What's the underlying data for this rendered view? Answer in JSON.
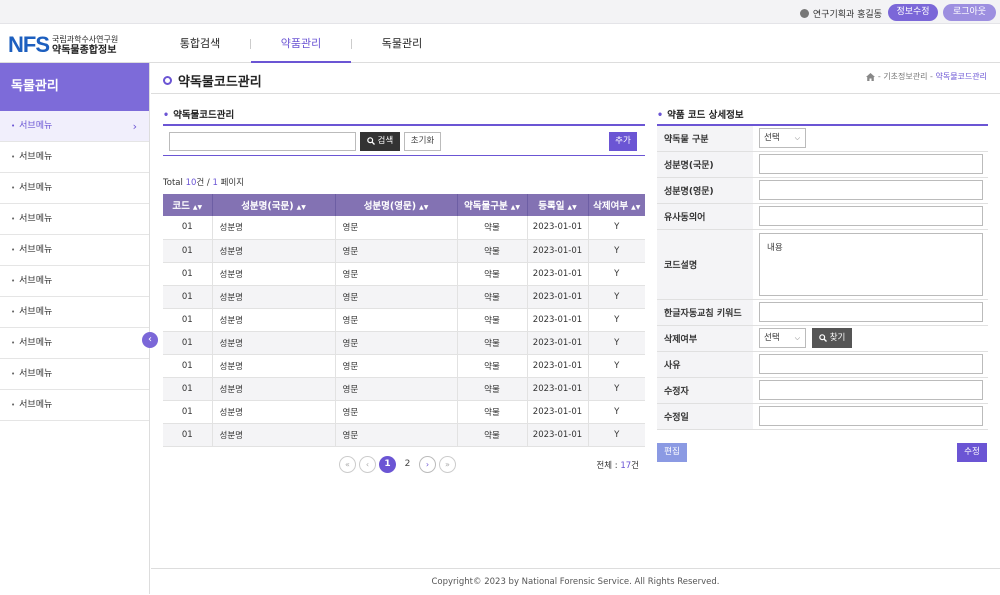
{
  "topbar": {
    "user_text": "연구기획과 홍길동",
    "profile_btn": "정보수정",
    "logout_btn": "로그아웃"
  },
  "logo": {
    "mark": "NFS",
    "org_line1": "국립과학수사연구원",
    "org_line2": "약독물종합정보"
  },
  "gnb": [
    {
      "label": "통합검색"
    },
    {
      "label": "약품관리"
    },
    {
      "label": "독물관리"
    }
  ],
  "sidebar": {
    "title": "독물관리",
    "items": [
      {
        "label": "서브메뉴"
      },
      {
        "label": "서브메뉴"
      },
      {
        "label": "서브메뉴"
      },
      {
        "label": "서브메뉴"
      },
      {
        "label": "서브메뉴"
      },
      {
        "label": "서브메뉴"
      },
      {
        "label": "서브메뉴"
      },
      {
        "label": "서브메뉴"
      },
      {
        "label": "서브메뉴"
      },
      {
        "label": "서브메뉴"
      }
    ]
  },
  "page": {
    "title": "약독물코드관리",
    "breadcrumb": {
      "path": "- 기초정보관리 -",
      "current": "약독물코드관리"
    }
  },
  "list": {
    "section_title": "약독물코드관리",
    "search_btn": "검색",
    "reset_btn": "초기화",
    "add_btn": "추가",
    "total_prefix": "Total ",
    "total_count": "10",
    "total_mid": "건 / ",
    "total_pages": "1",
    "total_suffix": " 페이지",
    "columns": [
      "코드",
      "성분명(국문)",
      "성분명(영문)",
      "약독물구분",
      "등록일",
      "삭제여부"
    ],
    "rows": [
      {
        "code": "01",
        "kor": "성분명",
        "eng": "영문",
        "type": "약물",
        "date": "2023-01-01",
        "del": "Y"
      },
      {
        "code": "01",
        "kor": "성분명",
        "eng": "영문",
        "type": "약물",
        "date": "2023-01-01",
        "del": "Y"
      },
      {
        "code": "01",
        "kor": "성분명",
        "eng": "영문",
        "type": "약물",
        "date": "2023-01-01",
        "del": "Y"
      },
      {
        "code": "01",
        "kor": "성분명",
        "eng": "영문",
        "type": "약물",
        "date": "2023-01-01",
        "del": "Y"
      },
      {
        "code": "01",
        "kor": "성분명",
        "eng": "영문",
        "type": "약물",
        "date": "2023-01-01",
        "del": "Y"
      },
      {
        "code": "01",
        "kor": "성분명",
        "eng": "영문",
        "type": "약물",
        "date": "2023-01-01",
        "del": "Y"
      },
      {
        "code": "01",
        "kor": "성분명",
        "eng": "영문",
        "type": "약물",
        "date": "2023-01-01",
        "del": "Y"
      },
      {
        "code": "01",
        "kor": "성분명",
        "eng": "영문",
        "type": "약물",
        "date": "2023-01-01",
        "del": "Y"
      },
      {
        "code": "01",
        "kor": "성분명",
        "eng": "영문",
        "type": "약물",
        "date": "2023-01-01",
        "del": "Y"
      },
      {
        "code": "01",
        "kor": "성분명",
        "eng": "영문",
        "type": "약물",
        "date": "2023-01-01",
        "del": "Y"
      }
    ],
    "pages": [
      "1",
      "2"
    ],
    "all_prefix": "전체 : ",
    "all_count": "17",
    "all_suffix": "건"
  },
  "detail": {
    "section_title": "약품 코드 상세정보",
    "labels": {
      "type": "약독물 구분",
      "kor": "성분명(국문)",
      "eng": "성분명(영문)",
      "synonym": "유사동의어",
      "desc": "코드설명",
      "keyword": "한글자동교침 키워드",
      "delete": "삭제여부",
      "reason": "사유",
      "modifier": "수정자",
      "modified": "수정일"
    },
    "type_select": "선택",
    "desc_value": "내용",
    "delete_select": "선택",
    "find_btn": "찾기",
    "edit_btn": "편집",
    "modify_btn": "수정"
  },
  "footer": {
    "text": "Copyright© 2023 by National Forensic Service. All Rights Reserved."
  },
  "colors": {
    "accent": "#6b55d4",
    "sidebar_title": "#7d6bd9",
    "table_header": "#8372b3",
    "logo": "#1d5fbf"
  }
}
